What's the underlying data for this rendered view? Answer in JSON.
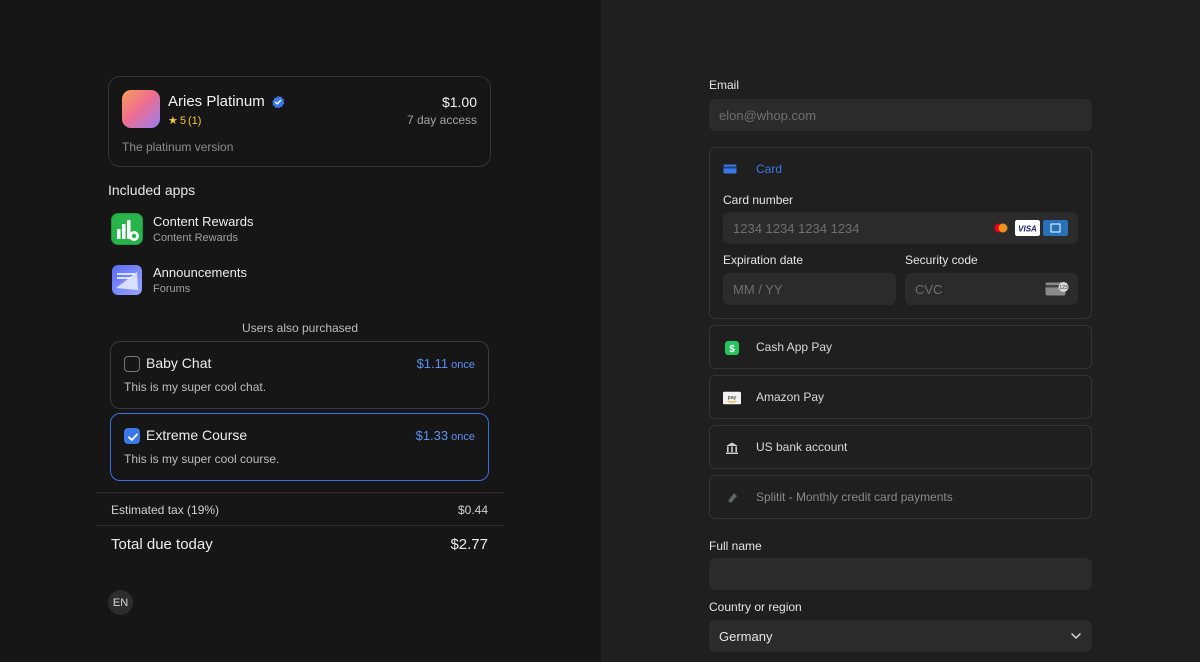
{
  "product": {
    "title": "Aries Platinum",
    "rating_value": "5",
    "rating_count": "(1)",
    "price": "$1.00",
    "access": "7 day access",
    "description": "The platinum version"
  },
  "included_apps": {
    "title": "Included apps",
    "items": [
      {
        "name": "Content Rewards",
        "sub": "Content Rewards"
      },
      {
        "name": "Announcements",
        "sub": "Forums"
      }
    ]
  },
  "upsells": {
    "title": "Users also purchased",
    "items": [
      {
        "name": "Baby Chat",
        "price": "$1.11",
        "period": "once",
        "desc": "This is my super cool chat.",
        "checked": false
      },
      {
        "name": "Extreme Course",
        "price": "$1.33",
        "period": "once",
        "desc": "This is my super cool course.",
        "checked": true
      }
    ]
  },
  "summary": {
    "tax_label": "Estimated tax (19%)",
    "tax_value": "$0.44",
    "total_label": "Total due today",
    "total_value": "$2.77"
  },
  "language": "EN",
  "form": {
    "email_label": "Email",
    "email_placeholder": "elon@whop.com",
    "card_tab_label": "Card",
    "card_number_label": "Card number",
    "card_number_placeholder": "1234 1234 1234 1234",
    "expiration_label": "Expiration date",
    "expiration_placeholder": "MM / YY",
    "security_label": "Security code",
    "security_placeholder": "CVC",
    "payment_methods": [
      {
        "label": "Cash App Pay",
        "icon": "cash-app-icon"
      },
      {
        "label": "Amazon Pay",
        "icon": "amazon-pay-icon"
      },
      {
        "label": "US bank account",
        "icon": "bank-icon"
      },
      {
        "label": "Splitit - Monthly credit card payments",
        "icon": "splitit-icon"
      }
    ],
    "full_name_label": "Full name",
    "full_name_value": "",
    "country_label": "Country or region",
    "country_value": "Germany"
  },
  "colors": {
    "accent": "#3a78e8",
    "price_blue": "#5b8ef0",
    "left_bg": "#161616",
    "right_bg": "#1f1f1f"
  }
}
